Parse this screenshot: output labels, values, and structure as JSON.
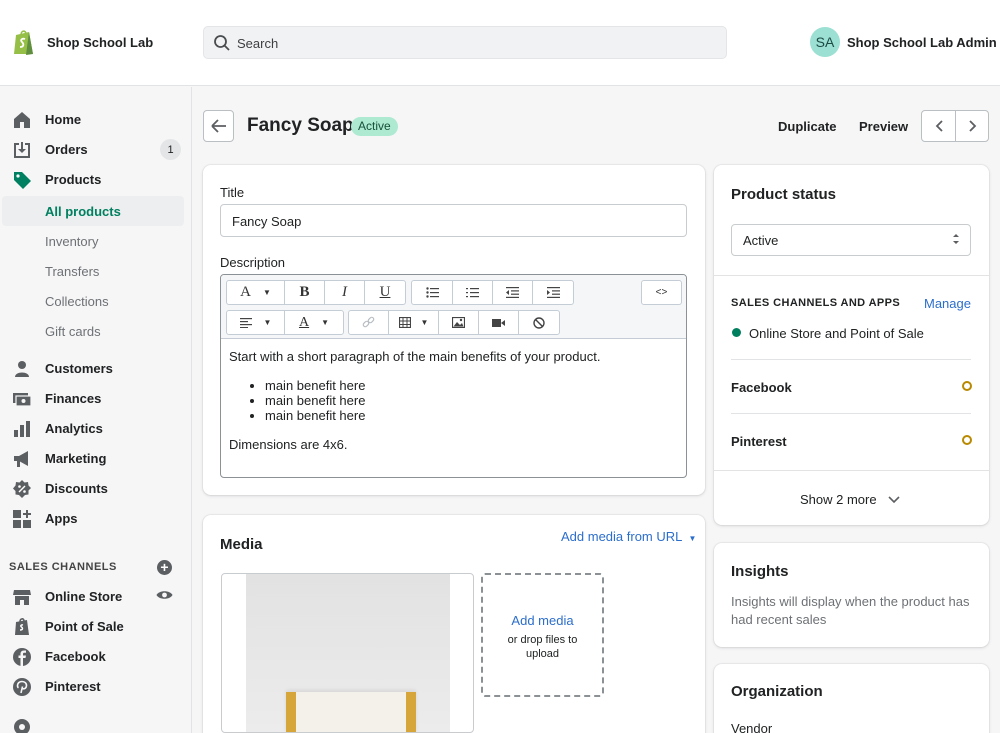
{
  "topbar": {
    "store_name": "Shop School Lab",
    "search_placeholder": "Search",
    "avatar_initials": "SA",
    "admin_name": "Shop School Lab Admin"
  },
  "sidebar": {
    "items": [
      {
        "label": "Home",
        "icon": "home-icon"
      },
      {
        "label": "Orders",
        "icon": "orders-icon",
        "badge": "1"
      },
      {
        "label": "Products",
        "icon": "tag-icon"
      }
    ],
    "product_subitems": [
      "All products",
      "Inventory",
      "Transfers",
      "Collections",
      "Gift cards"
    ],
    "more_items": [
      {
        "label": "Customers",
        "icon": "person-icon"
      },
      {
        "label": "Finances",
        "icon": "finances-icon"
      },
      {
        "label": "Analytics",
        "icon": "bar-chart-icon"
      },
      {
        "label": "Marketing",
        "icon": "megaphone-icon"
      },
      {
        "label": "Discounts",
        "icon": "discount-icon"
      },
      {
        "label": "Apps",
        "icon": "apps-icon"
      }
    ],
    "sales_channels_heading": "SALES CHANNELS",
    "channels": [
      {
        "label": "Online Store",
        "icon": "store-icon"
      },
      {
        "label": "Point of Sale",
        "icon": "pos-icon"
      },
      {
        "label": "Facebook",
        "icon": "facebook-icon"
      },
      {
        "label": "Pinterest",
        "icon": "pinterest-icon"
      }
    ]
  },
  "header": {
    "title": "Fancy Soap",
    "status": "Active",
    "duplicate_label": "Duplicate",
    "preview_label": "Preview"
  },
  "product_form": {
    "title_label": "Title",
    "title_value": "Fancy Soap",
    "description_label": "Description",
    "description_intro": "Start with a short paragraph of the main benefits of your product.",
    "description_bullets": [
      "main benefit here",
      "main benefit here",
      "main benefit here"
    ],
    "description_outro": "Dimensions are 4x6."
  },
  "media": {
    "title": "Media",
    "add_from_url": "Add media from URL",
    "add_media": "Add media",
    "drop_hint": "or drop files to upload"
  },
  "status_card": {
    "title": "Product status",
    "selected": "Active",
    "channels_heading": "SALES CHANNELS AND APPS",
    "manage_label": "Manage",
    "channels": [
      "Online Store and Point of Sale",
      "Facebook",
      "Pinterest"
    ],
    "show_more": "Show 2 more"
  },
  "insights": {
    "title": "Insights",
    "text": "Insights will display when the product has had recent sales"
  },
  "organization": {
    "title": "Organization",
    "vendor_label": "Vendor"
  },
  "colors": {
    "accent_green": "#008060",
    "link_blue": "#2c6ecb",
    "status_badge_bg": "#aee9d1",
    "pending_ring": "#b98900"
  }
}
